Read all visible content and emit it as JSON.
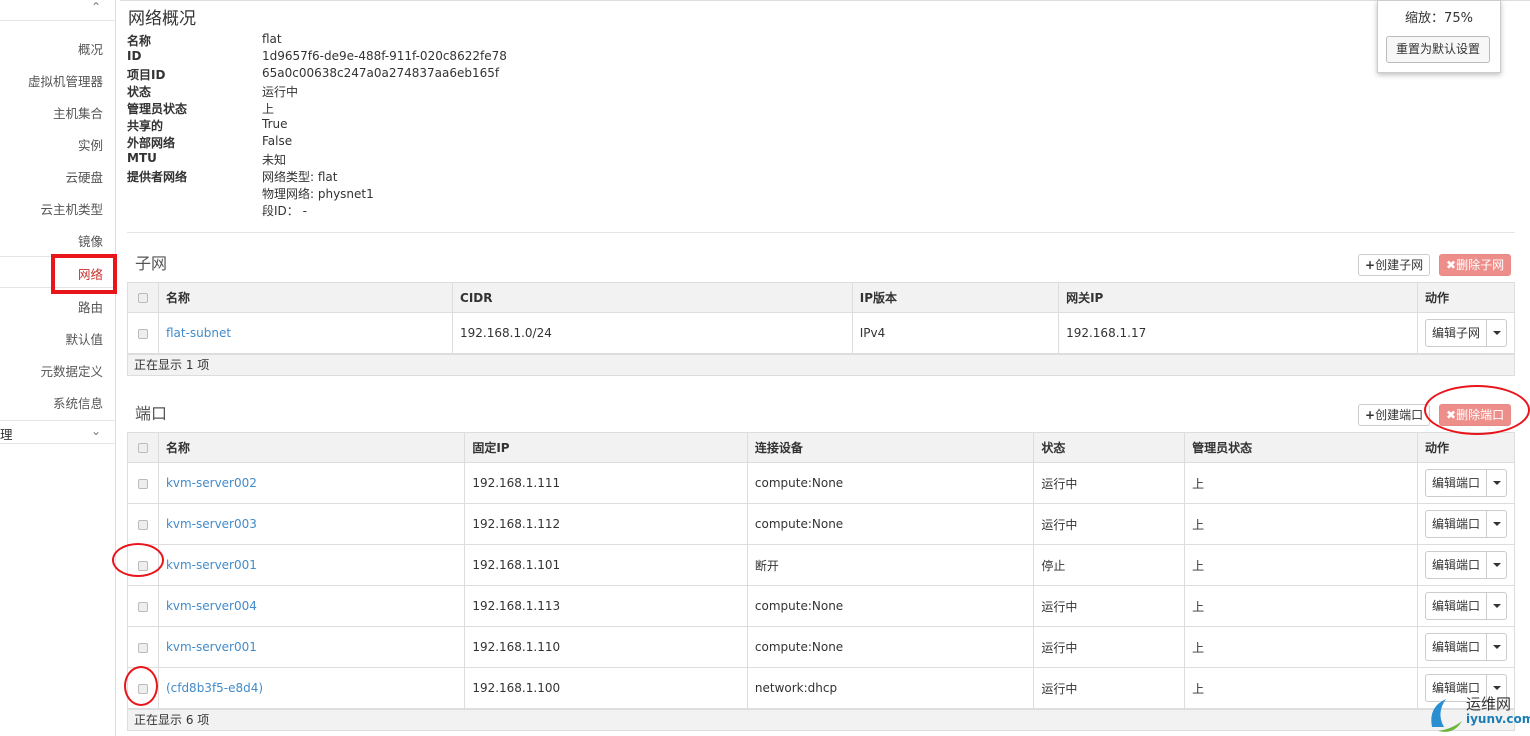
{
  "sidebar": {
    "items": [
      "概况",
      "虚拟机管理器",
      "主机集合",
      "实例",
      "云硬盘",
      "云主机类型",
      "镜像",
      "网络",
      "路由",
      "默认值",
      "元数据定义",
      "系统信息"
    ],
    "active_index": 7,
    "section_label": "理"
  },
  "overview": {
    "title": "网络概况",
    "fields": [
      {
        "k": "名称",
        "v": "flat"
      },
      {
        "k": "ID",
        "v": "1d9657f6-de9e-488f-911f-020c8622fe78"
      },
      {
        "k": "项目ID",
        "v": "65a0c00638c247a0a274837aa6eb165f"
      },
      {
        "k": "状态",
        "v": "运行中"
      },
      {
        "k": "管理员状态",
        "v": "上"
      },
      {
        "k": "共享的",
        "v": "True"
      },
      {
        "k": "外部网络",
        "v": "False"
      },
      {
        "k": "MTU",
        "v": "未知"
      },
      {
        "k": "提供者网络",
        "v": "网络类型: flat"
      },
      {
        "k": "",
        "v": "物理网络: physnet1"
      },
      {
        "k": "",
        "v": "段ID： -"
      }
    ]
  },
  "subnets": {
    "title": "子网",
    "create_label": "创建子网",
    "delete_label": "删除子网",
    "headers": [
      "名称",
      "CIDR",
      "IP版本",
      "网关IP",
      "动作"
    ],
    "rows": [
      {
        "name": "flat-subnet",
        "cidr": "192.168.1.0/24",
        "ipver": "IPv4",
        "gateway": "192.168.1.17",
        "action": "编辑子网"
      }
    ],
    "footer": "正在显示 1 项"
  },
  "ports": {
    "title": "端口",
    "create_label": "创建端口",
    "delete_label": "删除端口",
    "headers": [
      "名称",
      "固定IP",
      "连接设备",
      "状态",
      "管理员状态",
      "动作"
    ],
    "rows": [
      {
        "name": "kvm-server002",
        "ip": "192.168.1.111",
        "device": "compute:None",
        "status": "运行中",
        "admin": "上",
        "action": "编辑端口"
      },
      {
        "name": "kvm-server003",
        "ip": "192.168.1.112",
        "device": "compute:None",
        "status": "运行中",
        "admin": "上",
        "action": "编辑端口"
      },
      {
        "name": "kvm-server001",
        "ip": "192.168.1.101",
        "device": "断开",
        "status": "停止",
        "admin": "上",
        "action": "编辑端口"
      },
      {
        "name": "kvm-server004",
        "ip": "192.168.1.113",
        "device": "compute:None",
        "status": "运行中",
        "admin": "上",
        "action": "编辑端口"
      },
      {
        "name": "kvm-server001",
        "ip": "192.168.1.110",
        "device": "compute:None",
        "status": "运行中",
        "admin": "上",
        "action": "编辑端口"
      },
      {
        "name": "(cfd8b3f5-e8d4)",
        "ip": "192.168.1.100",
        "device": "network:dhcp",
        "status": "运行中",
        "admin": "上",
        "action": "编辑端口"
      }
    ],
    "footer": "正在显示 6 项"
  },
  "zoom": {
    "text": "缩放：75%",
    "reset_label": "重置为默认设置"
  },
  "watermark": {
    "line1": "运维网",
    "line2": "iyunv.com"
  },
  "colors": {
    "link": "#428bca",
    "danger": "#ee8e8b",
    "annotation": "#e8151b"
  }
}
